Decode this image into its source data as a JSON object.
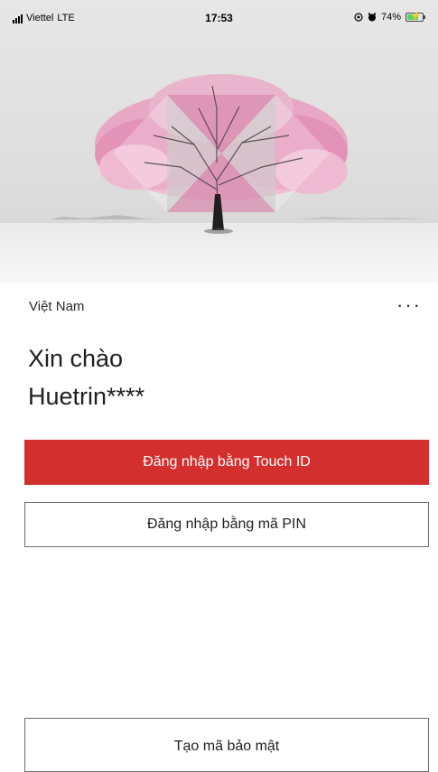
{
  "status_bar": {
    "carrier": "Viettel",
    "network": "LTE",
    "time": "17:53",
    "battery_percent": "74%",
    "battery_level": 0.74,
    "icons": [
      "signal-icon",
      "location-icon",
      "alarm-icon",
      "battery-charging-icon"
    ]
  },
  "hero": {
    "image": "tree-with-pink-blossoms-in-snow-with-logo-overlay"
  },
  "region": {
    "label": "Việt Nam",
    "more_label": "···"
  },
  "greeting": {
    "line1": "Xin chào",
    "username": "Huetrin****"
  },
  "buttons": {
    "touch_id": "Đăng nhập bằng Touch ID",
    "pin": "Đăng nhập bằng mã PIN",
    "security_code": "Tạo mã bảo mật"
  },
  "colors": {
    "primary": "#d32f2f",
    "text": "#202020",
    "border": "#6e6e6e"
  }
}
